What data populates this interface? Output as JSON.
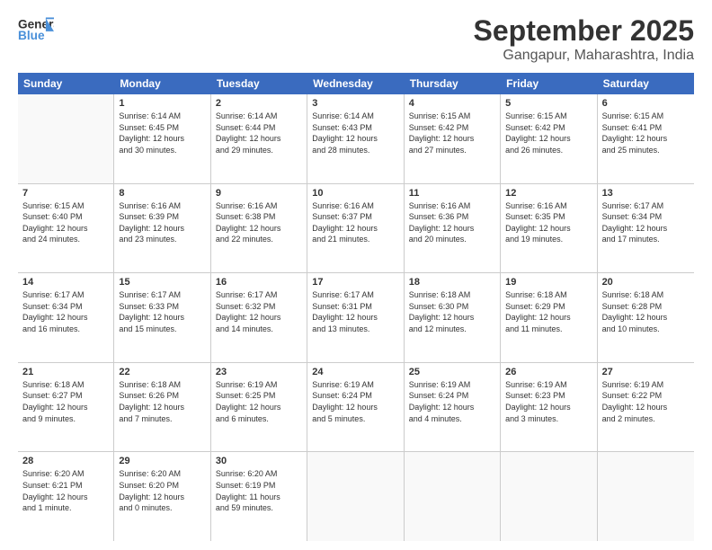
{
  "header": {
    "logo_line1": "General",
    "logo_line2": "Blue",
    "main_title": "September 2025",
    "sub_title": "Gangapur, Maharashtra, India"
  },
  "calendar": {
    "weekdays": [
      "Sunday",
      "Monday",
      "Tuesday",
      "Wednesday",
      "Thursday",
      "Friday",
      "Saturday"
    ],
    "rows": [
      [
        {
          "day": "",
          "info": ""
        },
        {
          "day": "1",
          "info": "Sunrise: 6:14 AM\nSunset: 6:45 PM\nDaylight: 12 hours\nand 30 minutes."
        },
        {
          "day": "2",
          "info": "Sunrise: 6:14 AM\nSunset: 6:44 PM\nDaylight: 12 hours\nand 29 minutes."
        },
        {
          "day": "3",
          "info": "Sunrise: 6:14 AM\nSunset: 6:43 PM\nDaylight: 12 hours\nand 28 minutes."
        },
        {
          "day": "4",
          "info": "Sunrise: 6:15 AM\nSunset: 6:42 PM\nDaylight: 12 hours\nand 27 minutes."
        },
        {
          "day": "5",
          "info": "Sunrise: 6:15 AM\nSunset: 6:42 PM\nDaylight: 12 hours\nand 26 minutes."
        },
        {
          "day": "6",
          "info": "Sunrise: 6:15 AM\nSunset: 6:41 PM\nDaylight: 12 hours\nand 25 minutes."
        }
      ],
      [
        {
          "day": "7",
          "info": "Sunrise: 6:15 AM\nSunset: 6:40 PM\nDaylight: 12 hours\nand 24 minutes."
        },
        {
          "day": "8",
          "info": "Sunrise: 6:16 AM\nSunset: 6:39 PM\nDaylight: 12 hours\nand 23 minutes."
        },
        {
          "day": "9",
          "info": "Sunrise: 6:16 AM\nSunset: 6:38 PM\nDaylight: 12 hours\nand 22 minutes."
        },
        {
          "day": "10",
          "info": "Sunrise: 6:16 AM\nSunset: 6:37 PM\nDaylight: 12 hours\nand 21 minutes."
        },
        {
          "day": "11",
          "info": "Sunrise: 6:16 AM\nSunset: 6:36 PM\nDaylight: 12 hours\nand 20 minutes."
        },
        {
          "day": "12",
          "info": "Sunrise: 6:16 AM\nSunset: 6:35 PM\nDaylight: 12 hours\nand 19 minutes."
        },
        {
          "day": "13",
          "info": "Sunrise: 6:17 AM\nSunset: 6:34 PM\nDaylight: 12 hours\nand 17 minutes."
        }
      ],
      [
        {
          "day": "14",
          "info": "Sunrise: 6:17 AM\nSunset: 6:34 PM\nDaylight: 12 hours\nand 16 minutes."
        },
        {
          "day": "15",
          "info": "Sunrise: 6:17 AM\nSunset: 6:33 PM\nDaylight: 12 hours\nand 15 minutes."
        },
        {
          "day": "16",
          "info": "Sunrise: 6:17 AM\nSunset: 6:32 PM\nDaylight: 12 hours\nand 14 minutes."
        },
        {
          "day": "17",
          "info": "Sunrise: 6:17 AM\nSunset: 6:31 PM\nDaylight: 12 hours\nand 13 minutes."
        },
        {
          "day": "18",
          "info": "Sunrise: 6:18 AM\nSunset: 6:30 PM\nDaylight: 12 hours\nand 12 minutes."
        },
        {
          "day": "19",
          "info": "Sunrise: 6:18 AM\nSunset: 6:29 PM\nDaylight: 12 hours\nand 11 minutes."
        },
        {
          "day": "20",
          "info": "Sunrise: 6:18 AM\nSunset: 6:28 PM\nDaylight: 12 hours\nand 10 minutes."
        }
      ],
      [
        {
          "day": "21",
          "info": "Sunrise: 6:18 AM\nSunset: 6:27 PM\nDaylight: 12 hours\nand 9 minutes."
        },
        {
          "day": "22",
          "info": "Sunrise: 6:18 AM\nSunset: 6:26 PM\nDaylight: 12 hours\nand 7 minutes."
        },
        {
          "day": "23",
          "info": "Sunrise: 6:19 AM\nSunset: 6:25 PM\nDaylight: 12 hours\nand 6 minutes."
        },
        {
          "day": "24",
          "info": "Sunrise: 6:19 AM\nSunset: 6:24 PM\nDaylight: 12 hours\nand 5 minutes."
        },
        {
          "day": "25",
          "info": "Sunrise: 6:19 AM\nSunset: 6:24 PM\nDaylight: 12 hours\nand 4 minutes."
        },
        {
          "day": "26",
          "info": "Sunrise: 6:19 AM\nSunset: 6:23 PM\nDaylight: 12 hours\nand 3 minutes."
        },
        {
          "day": "27",
          "info": "Sunrise: 6:19 AM\nSunset: 6:22 PM\nDaylight: 12 hours\nand 2 minutes."
        }
      ],
      [
        {
          "day": "28",
          "info": "Sunrise: 6:20 AM\nSunset: 6:21 PM\nDaylight: 12 hours\nand 1 minute."
        },
        {
          "day": "29",
          "info": "Sunrise: 6:20 AM\nSunset: 6:20 PM\nDaylight: 12 hours\nand 0 minutes."
        },
        {
          "day": "30",
          "info": "Sunrise: 6:20 AM\nSunset: 6:19 PM\nDaylight: 11 hours\nand 59 minutes."
        },
        {
          "day": "",
          "info": ""
        },
        {
          "day": "",
          "info": ""
        },
        {
          "day": "",
          "info": ""
        },
        {
          "day": "",
          "info": ""
        }
      ]
    ]
  }
}
